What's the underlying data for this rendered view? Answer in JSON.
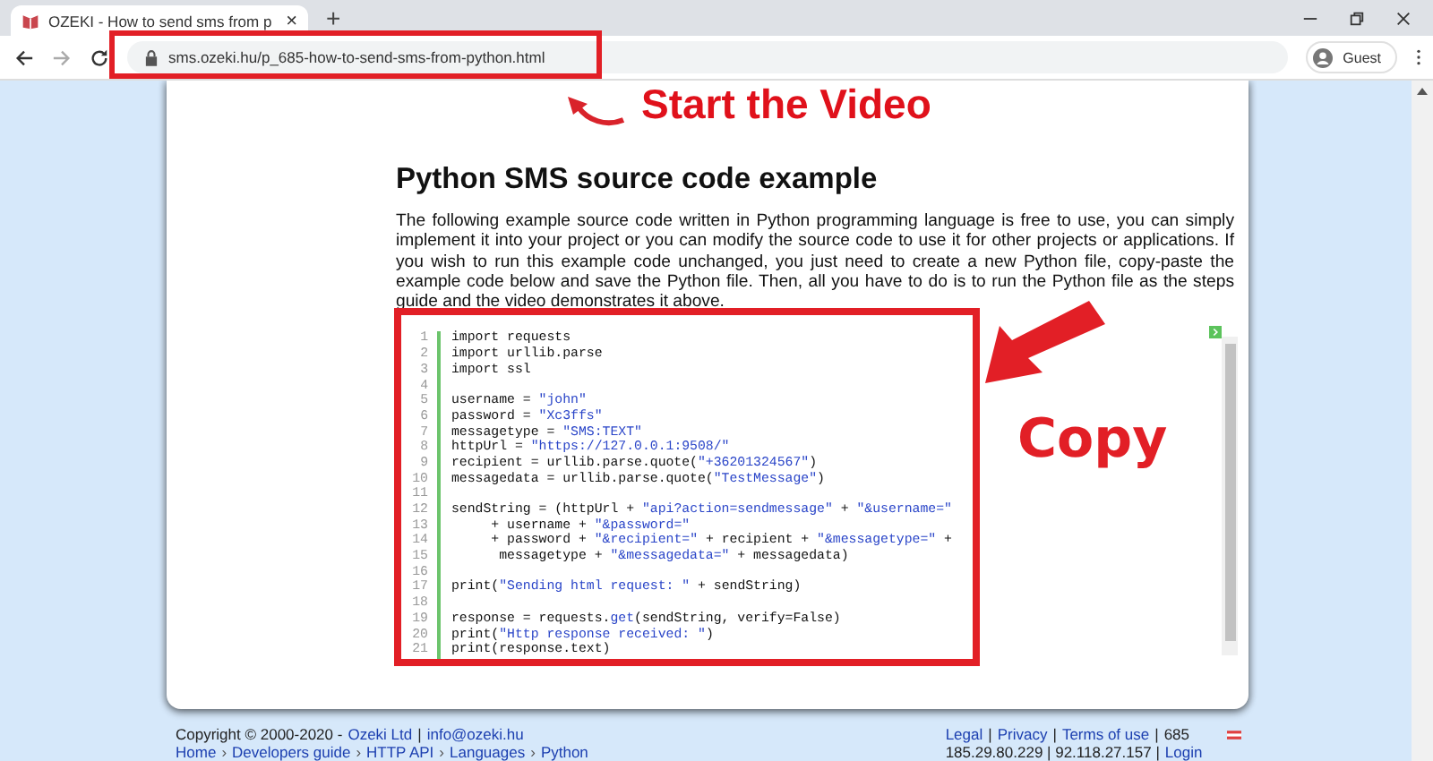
{
  "browser": {
    "tab": {
      "title": "OZEKI - How to send sms from p",
      "close": "×"
    },
    "new_tab": "+",
    "url": "sms.ozeki.hu/p_685-how-to-send-sms-from-python.html",
    "profile": "Guest"
  },
  "annotations": {
    "video_label": "Start the Video",
    "copy_label": "Copy"
  },
  "article": {
    "heading": "Python SMS source code example",
    "paragraph": "The following example source code written in Python programming language is free to use, you can simply implement it into your project or you can modify the source code to use it for other projects or applications. If you wish to run this example code unchanged, you just need to create a new Python file, copy-paste the example code below and save the Python file. Then, all you have to do is to run the Python file as the steps guide and the video demonstrates it above.",
    "code": [
      {
        "number": "1",
        "segments": [
          {
            "kind": "plain",
            "text": "import requests"
          }
        ]
      },
      {
        "number": "2",
        "segments": [
          {
            "kind": "plain",
            "text": "import urllib.parse"
          }
        ]
      },
      {
        "number": "3",
        "segments": [
          {
            "kind": "plain",
            "text": "import ssl"
          }
        ]
      },
      {
        "number": "4"
      },
      {
        "number": "5",
        "segments": [
          {
            "kind": "plain",
            "text": "username = "
          },
          {
            "kind": "string",
            "text": "\"john\""
          }
        ]
      },
      {
        "number": "6",
        "segments": [
          {
            "kind": "plain",
            "text": "password = "
          },
          {
            "kind": "string",
            "text": "\"Xc3ffs\""
          }
        ]
      },
      {
        "number": "7",
        "segments": [
          {
            "kind": "plain",
            "text": "messagetype = "
          },
          {
            "kind": "string",
            "text": "\"SMS:TEXT\""
          }
        ]
      },
      {
        "number": "8",
        "segments": [
          {
            "kind": "plain",
            "text": "httpUrl = "
          },
          {
            "kind": "string",
            "text": "\"https://127.0.0.1:9508/\""
          }
        ]
      },
      {
        "number": "9",
        "segments": [
          {
            "kind": "plain",
            "text": "recipient = urllib.parse.quote("
          },
          {
            "kind": "string",
            "text": "\"+36201324567\""
          },
          {
            "kind": "plain",
            "text": ")"
          }
        ]
      },
      {
        "number": "10",
        "segments": [
          {
            "kind": "plain",
            "text": "messagedata = urllib.parse.quote("
          },
          {
            "kind": "string",
            "text": "\"TestMessage\""
          },
          {
            "kind": "plain",
            "text": ")"
          }
        ]
      },
      {
        "number": "11"
      },
      {
        "number": "12",
        "segments": [
          {
            "kind": "plain",
            "text": "sendString = (httpUrl + "
          },
          {
            "kind": "string",
            "text": "\"api?action=sendmessage\""
          },
          {
            "kind": "plain",
            "text": " + "
          },
          {
            "kind": "string",
            "text": "\"&username=\""
          }
        ]
      },
      {
        "number": "13",
        "segments": [
          {
            "kind": "plain",
            "text": "     + username + "
          },
          {
            "kind": "string",
            "text": "\"&password=\""
          }
        ]
      },
      {
        "number": "14",
        "segments": [
          {
            "kind": "plain",
            "text": "     + password + "
          },
          {
            "kind": "string",
            "text": "\"&recipient=\""
          },
          {
            "kind": "plain",
            "text": " + recipient + "
          },
          {
            "kind": "string",
            "text": "\"&messagetype=\""
          },
          {
            "kind": "plain",
            "text": " +"
          }
        ]
      },
      {
        "number": "15",
        "segments": [
          {
            "kind": "plain",
            "text": "      messagetype + "
          },
          {
            "kind": "string",
            "text": "\"&messagedata=\""
          },
          {
            "kind": "plain",
            "text": " + messagedata)"
          }
        ]
      },
      {
        "number": "16"
      },
      {
        "number": "17",
        "segments": [
          {
            "kind": "plain",
            "text": "print("
          },
          {
            "kind": "string",
            "text": "\"Sending html request: \""
          },
          {
            "kind": "plain",
            "text": " + sendString)"
          }
        ]
      },
      {
        "number": "18"
      },
      {
        "number": "19",
        "segments": [
          {
            "kind": "plain",
            "text": "response = requests."
          },
          {
            "kind": "builtin",
            "text": "get"
          },
          {
            "kind": "plain",
            "text": "(sendString, verify=False)"
          }
        ]
      },
      {
        "number": "20",
        "segments": [
          {
            "kind": "plain",
            "text": "print("
          },
          {
            "kind": "string",
            "text": "\"Http response received: \""
          },
          {
            "kind": "plain",
            "text": ")"
          }
        ]
      },
      {
        "number": "21",
        "segments": [
          {
            "kind": "plain",
            "text": "print(response.text)"
          }
        ]
      }
    ]
  },
  "footer": {
    "copyright": "Copyright © 2000-2020 -",
    "company_link": "Ozeki Ltd",
    "separator": "|",
    "email_link": "info@ozeki.hu",
    "breadcrumbs": [
      "Home",
      "Developers guide",
      "HTTP API",
      "Languages",
      "Python"
    ],
    "breadcrumb_separator": "›",
    "links": [
      "Legal",
      "Privacy",
      "Terms of use"
    ],
    "counter": "685",
    "addresses": "185.29.80.229 | 92.118.27.157 |",
    "login_link": "Login"
  }
}
